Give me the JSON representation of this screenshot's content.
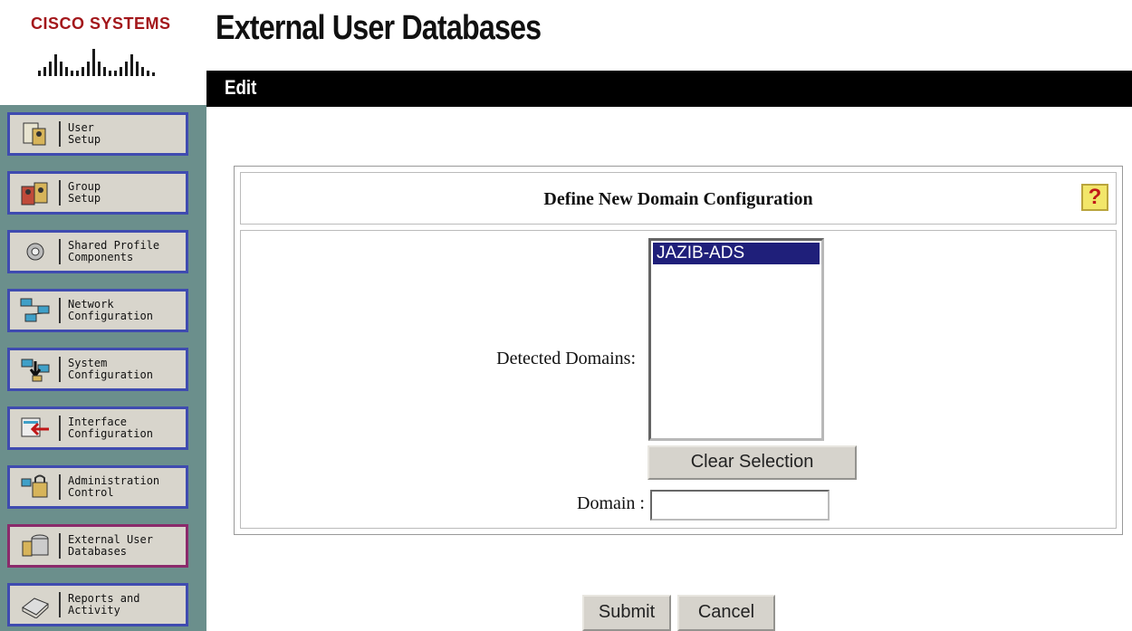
{
  "brand": {
    "name": "Cisco Systems",
    "color": "#a3171b"
  },
  "header": {
    "title": "External User Databases",
    "bar_label": "Edit"
  },
  "sidebar": {
    "items": [
      {
        "label": "User\nSetup",
        "icon": "user-setup-icon"
      },
      {
        "label": "Group\nSetup",
        "icon": "group-setup-icon"
      },
      {
        "label": "Shared Profile\nComponents",
        "icon": "shared-profile-icon"
      },
      {
        "label": "Network\nConfiguration",
        "icon": "network-config-icon"
      },
      {
        "label": "System\nConfiguration",
        "icon": "system-config-icon"
      },
      {
        "label": "Interface\nConfiguration",
        "icon": "interface-config-icon"
      },
      {
        "label": "Administration\nControl",
        "icon": "admin-control-icon"
      },
      {
        "label": "External User\nDatabases",
        "icon": "external-db-icon",
        "active": true
      },
      {
        "label": "Reports and\nActivity",
        "icon": "reports-icon"
      }
    ]
  },
  "panel": {
    "title": "Define New Domain Configuration",
    "help_symbol": "?",
    "detected_domains_label": "Detected Domains:",
    "detected_domains_options": [
      "JAZIB-ADS"
    ],
    "clear_button": "Clear Selection",
    "domain_label": "Domain :",
    "domain_value": ""
  },
  "actions": {
    "submit": "Submit",
    "cancel": "Cancel"
  }
}
